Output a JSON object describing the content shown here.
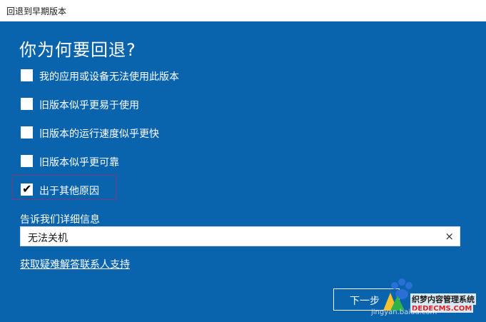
{
  "window": {
    "title": "回退到早期版本"
  },
  "heading": "你为何要回退?",
  "options": [
    {
      "label": "我的应用或设备无法使用此版本",
      "checked": false
    },
    {
      "label": "旧版本似乎更易于使用",
      "checked": false
    },
    {
      "label": "旧版本的运行速度似乎更快",
      "checked": false
    },
    {
      "label": "旧版本似乎更可靠",
      "checked": false
    },
    {
      "label": "出于其他原因",
      "checked": true
    }
  ],
  "details": {
    "label": "告诉我们详细信息",
    "value": "无法关机",
    "clear_icon": "×"
  },
  "help_link": "获取疑难解答联系人支持",
  "buttons": {
    "next": "下一步"
  },
  "watermark": {
    "brand": "织梦内容管理系统",
    "domain": "DEDECMS.COM",
    "url": "jingyan.baidu.com"
  },
  "colors": {
    "background": "#0a64ad",
    "highlight_border": "#7a3a80"
  }
}
